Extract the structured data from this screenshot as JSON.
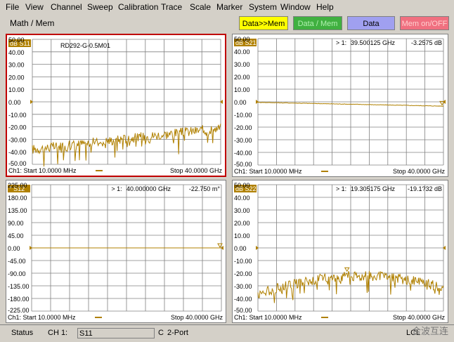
{
  "menu": [
    "File",
    "View",
    "Channel",
    "Sweep",
    "Calibration",
    "Trace",
    "Scale",
    "Marker",
    "System",
    "Window",
    "Help"
  ],
  "toolbar": {
    "label": "Math / Mem",
    "buttons": [
      {
        "label": "Data>>Mem",
        "bg": "#ffff00",
        "fg": "#000000"
      },
      {
        "label": "Data / Mem",
        "bg": "#40b040",
        "fg": "#b0f0b0"
      },
      {
        "label": "Data",
        "bg": "#a0a0f0",
        "fg": "#000000"
      },
      {
        "label": "Mem on/OFF",
        "bg": "#f07080",
        "fg": "#ffd0d0"
      }
    ]
  },
  "colors": {
    "trace": "#b08000",
    "grid": "#808080",
    "active": "#c00000"
  },
  "panels": [
    {
      "title": "dB S11",
      "marker": "",
      "marker_freq": "",
      "marker_val": "",
      "annotation": "RD292-G-0.5M01",
      "yticks": [
        "50.00",
        "40.00",
        "30.00",
        "20.00",
        "10.00",
        "0.00",
        "-10.00",
        "-20.00",
        "-30.00",
        "-40.00",
        "-50.00"
      ],
      "start": "Ch1: Start 10.0000 MHz",
      "stop": "Stop 40.0000 GHz",
      "active": true
    },
    {
      "title": "dB S21",
      "marker": "> 1:",
      "marker_freq": "39.500125 GHz",
      "marker_val": "-3.2575 dB",
      "annotation": "",
      "yticks": [
        "50.00",
        "40.00",
        "30.00",
        "20.00",
        "10.00",
        "0.00",
        "-10.00",
        "-20.00",
        "-30.00",
        "-40.00",
        "-50.00"
      ],
      "start": "Ch1: Start 10.0000 MHz",
      "stop": "Stop 40.0000 GHz",
      "active": false
    },
    {
      "title": "° S12",
      "marker": "> 1:",
      "marker_freq": "40.000000 GHz",
      "marker_val": "-22.750 m°",
      "annotation": "",
      "yticks": [
        "225.00",
        "180.00",
        "135.00",
        "90.00",
        "45.00",
        "0.00",
        "-45.00",
        "-90.00",
        "-135.00",
        "-180.00",
        "-225.00"
      ],
      "start": "Ch1: Start 10.0000 MHz",
      "stop": "Stop 40.0000 GHz",
      "active": false
    },
    {
      "title": "dB S22",
      "marker": "> 1:",
      "marker_freq": "19.305175 GHz",
      "marker_val": "-19.1?32 dB",
      "annotation": "",
      "yticks": [
        "50.00",
        "40.00",
        "30.00",
        "20.00",
        "10.00",
        "0.00",
        "-10.00",
        "-20.00",
        "-30.00",
        "-40.00",
        "-50.00"
      ],
      "start": "Ch1: Start 10.0000 MHz",
      "stop": "Stop 40.0000 GHz",
      "active": false
    }
  ],
  "status": {
    "label": "Status",
    "channel": "CH 1:",
    "param": "S11",
    "c": "C",
    "port": "2-Port",
    "lcl": "LCL",
    "watermark": "合波互连"
  }
}
